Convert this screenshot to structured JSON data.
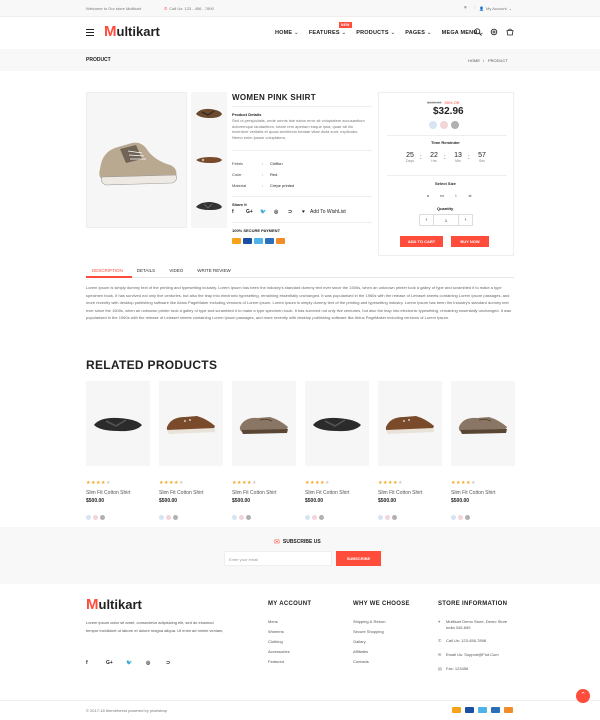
{
  "topbar": {
    "welcome": "Welcome to Our store Multikart",
    "call": "Call Us: 123 - 456 - 7890",
    "account": "My Account"
  },
  "brand": {
    "m": "M",
    "rest": "ultikart"
  },
  "nav": {
    "items": [
      "HOME",
      "FEATURES",
      "PRODUCTS",
      "PAGES",
      "MEGA MENU"
    ],
    "new_badge": "NEW"
  },
  "breadcrumb": {
    "title": "PRODUCT",
    "home": "HOME",
    "sep": "/",
    "current": "PRODUCT"
  },
  "product": {
    "title": "WOMEN PINK SHIRT",
    "details_heading": "Product Details",
    "details_text": "Sed ut perspiciatis, unde omnis iste natus error sit voluptatem accusantium doloremque laudantium, totam rem aperiam eaque ipsa, quae ab illo inventore veritatis et quasi architecto beatae vitae dicta sunt, explicabo. Nemo enim ipsam voluptatem,",
    "specs": [
      {
        "k": "Febric",
        "v": "Chiffon"
      },
      {
        "k": "Color",
        "v": "Red"
      },
      {
        "k": "Material",
        "v": "Crepe printed"
      }
    ],
    "share_label": "Share It",
    "wishlist": "Add To WishList",
    "secure": "100% SECURE PAYMENT"
  },
  "buybox": {
    "old_price": "$459.00",
    "discount": "55% Off",
    "price": "$32.96",
    "colors": [
      "#d6e4f3",
      "#f2d4d9",
      "#b0b0b0"
    ],
    "timer_label": "Time Reminder",
    "timer": [
      {
        "n": "25",
        "l": "Days"
      },
      {
        "n": "22",
        "l": "Hrs"
      },
      {
        "n": "13",
        "l": "Min"
      },
      {
        "n": "57",
        "l": "Sec"
      }
    ],
    "size_label": "Select Size",
    "sizes": [
      "s",
      "m",
      "l",
      "xl"
    ],
    "qty_label": "Quantity",
    "qty": "1",
    "minus": "‹",
    "plus": "›",
    "cart": "ADD TO CART",
    "buy": "BUY NOW"
  },
  "tabs": [
    "DESCRIPTION",
    "DETAILS",
    "VIDEO",
    "WRITE REVIEW"
  ],
  "description": "Lorem Ipsum is simply dummy text of the printing and typesetting industry. Lorem Ipsum has been the industry's standard dummy text ever since the 1500s, when an unknown printer took a galley of type and scrambled it to make a type specimen book. It has survived not only five centuries, but also the leap into electronic typesetting, remaining essentially unchanged. It was popularised in the 1960s with the release of Letraset sheets containing Lorem Ipsum passages, and more recently with desktop publishing software like Aldus PageMaker including versions of Lorem Ipsum. Lorem Ipsum is simply dummy text of the printing and typesetting industry. Lorem Ipsum has been the industry's standard dummy text ever since the 1500s, when an unknown printer took a galley of type and scrambled it to make a type specimen book. It has survived not only five centuries, but also the leap into electronic typesetting, remaining essentially unchanged. It was popularised in the 1960s with the release of Letraset sheets containing Lorem Ipsum passages, and more recently with desktop publishing software like Aldus PageMaker including versions of Lorem Ipsum.",
  "related": {
    "heading": "RELATED PRODUCTS",
    "items": [
      {
        "name": "Slim Fit Cotton Shirt",
        "price": "$500.00",
        "rating": 4,
        "shoe": "flipflop"
      },
      {
        "name": "Slim Fit Cotton Shirt",
        "price": "$500.00",
        "rating": 4,
        "shoe": "boat"
      },
      {
        "name": "Slim Fit Cotton Shirt",
        "price": "$500.00",
        "rating": 4,
        "shoe": "loafer"
      },
      {
        "name": "Slim Fit Cotton Shirt",
        "price": "$500.00",
        "rating": 4,
        "shoe": "flipflop"
      },
      {
        "name": "Slim Fit Cotton Shirt",
        "price": "$500.00",
        "rating": 4,
        "shoe": "boat"
      },
      {
        "name": "Slim Fit Cotton Shirt",
        "price": "$500.00",
        "rating": 4,
        "shoe": "loafer"
      }
    ]
  },
  "subscribe": {
    "heading": "SUBSCRIBE US",
    "placeholder": "Enter your email",
    "button": "SUBSCRIBE"
  },
  "footer": {
    "about": "Lorem ipsum dolor sit amet, consectetur adipisicing elit, sed do eiusmod tempor incididunt ut labore et dolore magna aliqua. Ut enim ad minim veniam,",
    "account_heading": "MY ACCOUNT",
    "account_links": [
      "Mens",
      "Womens",
      "Clothing",
      "Accessories",
      "Featured"
    ],
    "why_heading": "WHY WE CHOOSE",
    "why_links": [
      "Shipping & Return",
      "Secure Shopping",
      "Gallary",
      "Affiliates",
      "Contacts"
    ],
    "store_heading": "STORE INFORMATION",
    "store": [
      {
        "icon": "location-icon",
        "text": "Multikart Demo Store, Demo Store India 345-659"
      },
      {
        "icon": "phone-icon",
        "text": "Call Us: 123-456-7898"
      },
      {
        "icon": "email-icon",
        "text": "Email Us: Support@Fiot.Com"
      },
      {
        "icon": "fax-icon",
        "text": "Fax: 123456"
      }
    ],
    "copyright": "© 2017-18 themeforest powered by pixelstrap"
  },
  "colors": {
    "accent": "#ff4c3b",
    "dark": "#222222",
    "star": "#f5a623"
  }
}
